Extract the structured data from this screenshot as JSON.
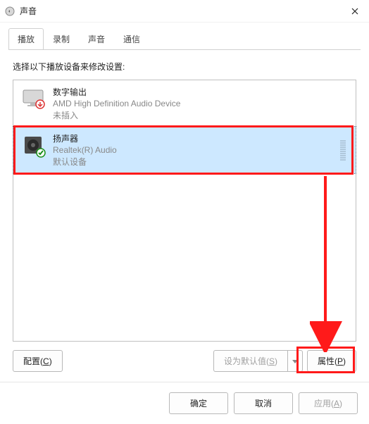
{
  "window": {
    "title": "声音"
  },
  "tabs": [
    "播放",
    "录制",
    "声音",
    "通信"
  ],
  "active_tab_index": 0,
  "instruction": "选择以下播放设备来修改设置:",
  "devices": [
    {
      "name": "数字输出",
      "description": "AMD High Definition Audio Device",
      "status": "未插入",
      "icon": "monitor",
      "badge": "unplugged",
      "selected": false
    },
    {
      "name": "扬声器",
      "description": "Realtek(R) Audio",
      "status": "默认设备",
      "icon": "speaker",
      "badge": "check",
      "selected": true
    }
  ],
  "buttons": {
    "configure": "配置",
    "configure_mn": "C",
    "set_default": "设为默认值",
    "set_default_mn": "S",
    "properties": "属性",
    "properties_mn": "P",
    "ok": "确定",
    "cancel": "取消",
    "apply": "应用",
    "apply_mn": "A"
  }
}
